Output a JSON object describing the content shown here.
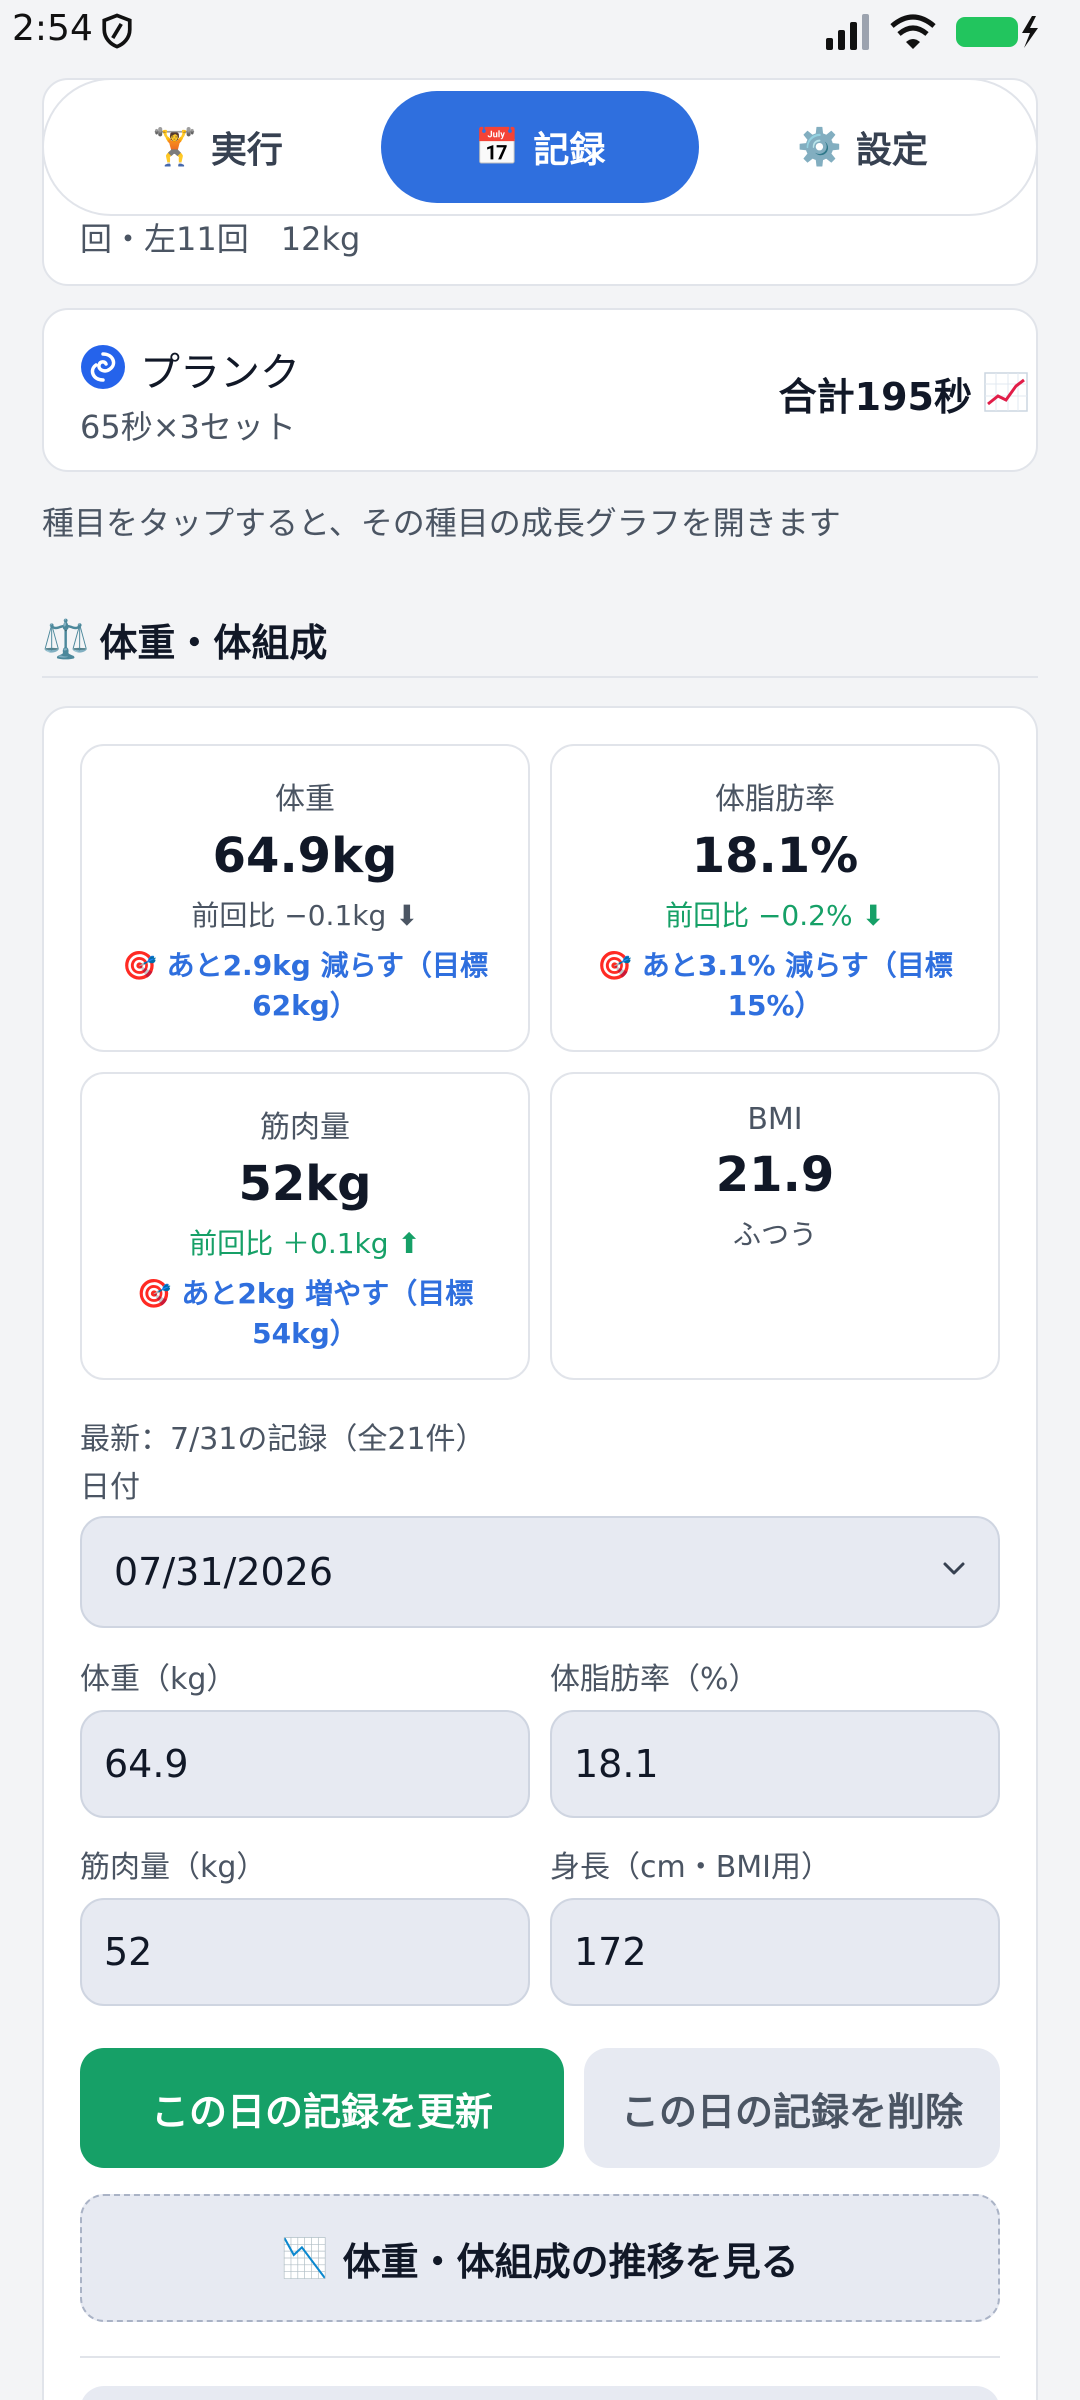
{
  "status": {
    "time": "2:54"
  },
  "tabs": [
    {
      "label": "実行",
      "icon": "🏋"
    },
    {
      "label": "記録",
      "icon": "📅"
    },
    {
      "label": "設定",
      "icon": "⚙️"
    }
  ],
  "previous_item_text": "回・左11回　12kg",
  "plank": {
    "name": "プランク",
    "sub": "65秒×3セット",
    "total": "合計195秒"
  },
  "hint": "種目をタップすると、その種目の成長グラフを開きます",
  "section": {
    "icon": "⚖️",
    "title": "体重・体組成"
  },
  "stats": {
    "weight": {
      "label": "体重",
      "value": "64.9kg",
      "diff": "前回比 −0.1kg ⬇",
      "goal_icon": "🎯",
      "goal": "あと2.9kg 減らす（目標62kg）"
    },
    "bodyfat": {
      "label": "体脂肪率",
      "value": "18.1%",
      "diff": "前回比 −0.2% ⬇",
      "goal_icon": "🎯",
      "goal": "あと3.1% 減らす（目標15%）"
    },
    "muscle": {
      "label": "筋肉量",
      "value": "52kg",
      "diff": "前回比 ＋0.1kg ⬆",
      "goal_icon": "🎯",
      "goal": "あと2kg 増やす（目標54kg）"
    },
    "bmi": {
      "label": "BMI",
      "value": "21.9",
      "status": "ふつう"
    }
  },
  "latest": "最新：7/31の記録（全21件）",
  "date": {
    "label": "日付",
    "value": "07/31/2026"
  },
  "fields": {
    "weight": {
      "label": "体重（kg）",
      "value": "64.9"
    },
    "bodyfat": {
      "label": "体脂肪率（%）",
      "value": "18.1"
    },
    "muscle": {
      "label": "筋肉量（kg）",
      "value": "52"
    },
    "height": {
      "label": "身長（cm・BMI用）",
      "value": "172"
    }
  },
  "buttons": {
    "update": "この日の記録を更新",
    "delete": "この日の記録を削除",
    "trend": "体重・体組成の推移を見る",
    "trend_icon": "📉"
  },
  "colors": {
    "accent": "#2f6fde",
    "success": "#16a067",
    "goal": "#e11d48"
  }
}
